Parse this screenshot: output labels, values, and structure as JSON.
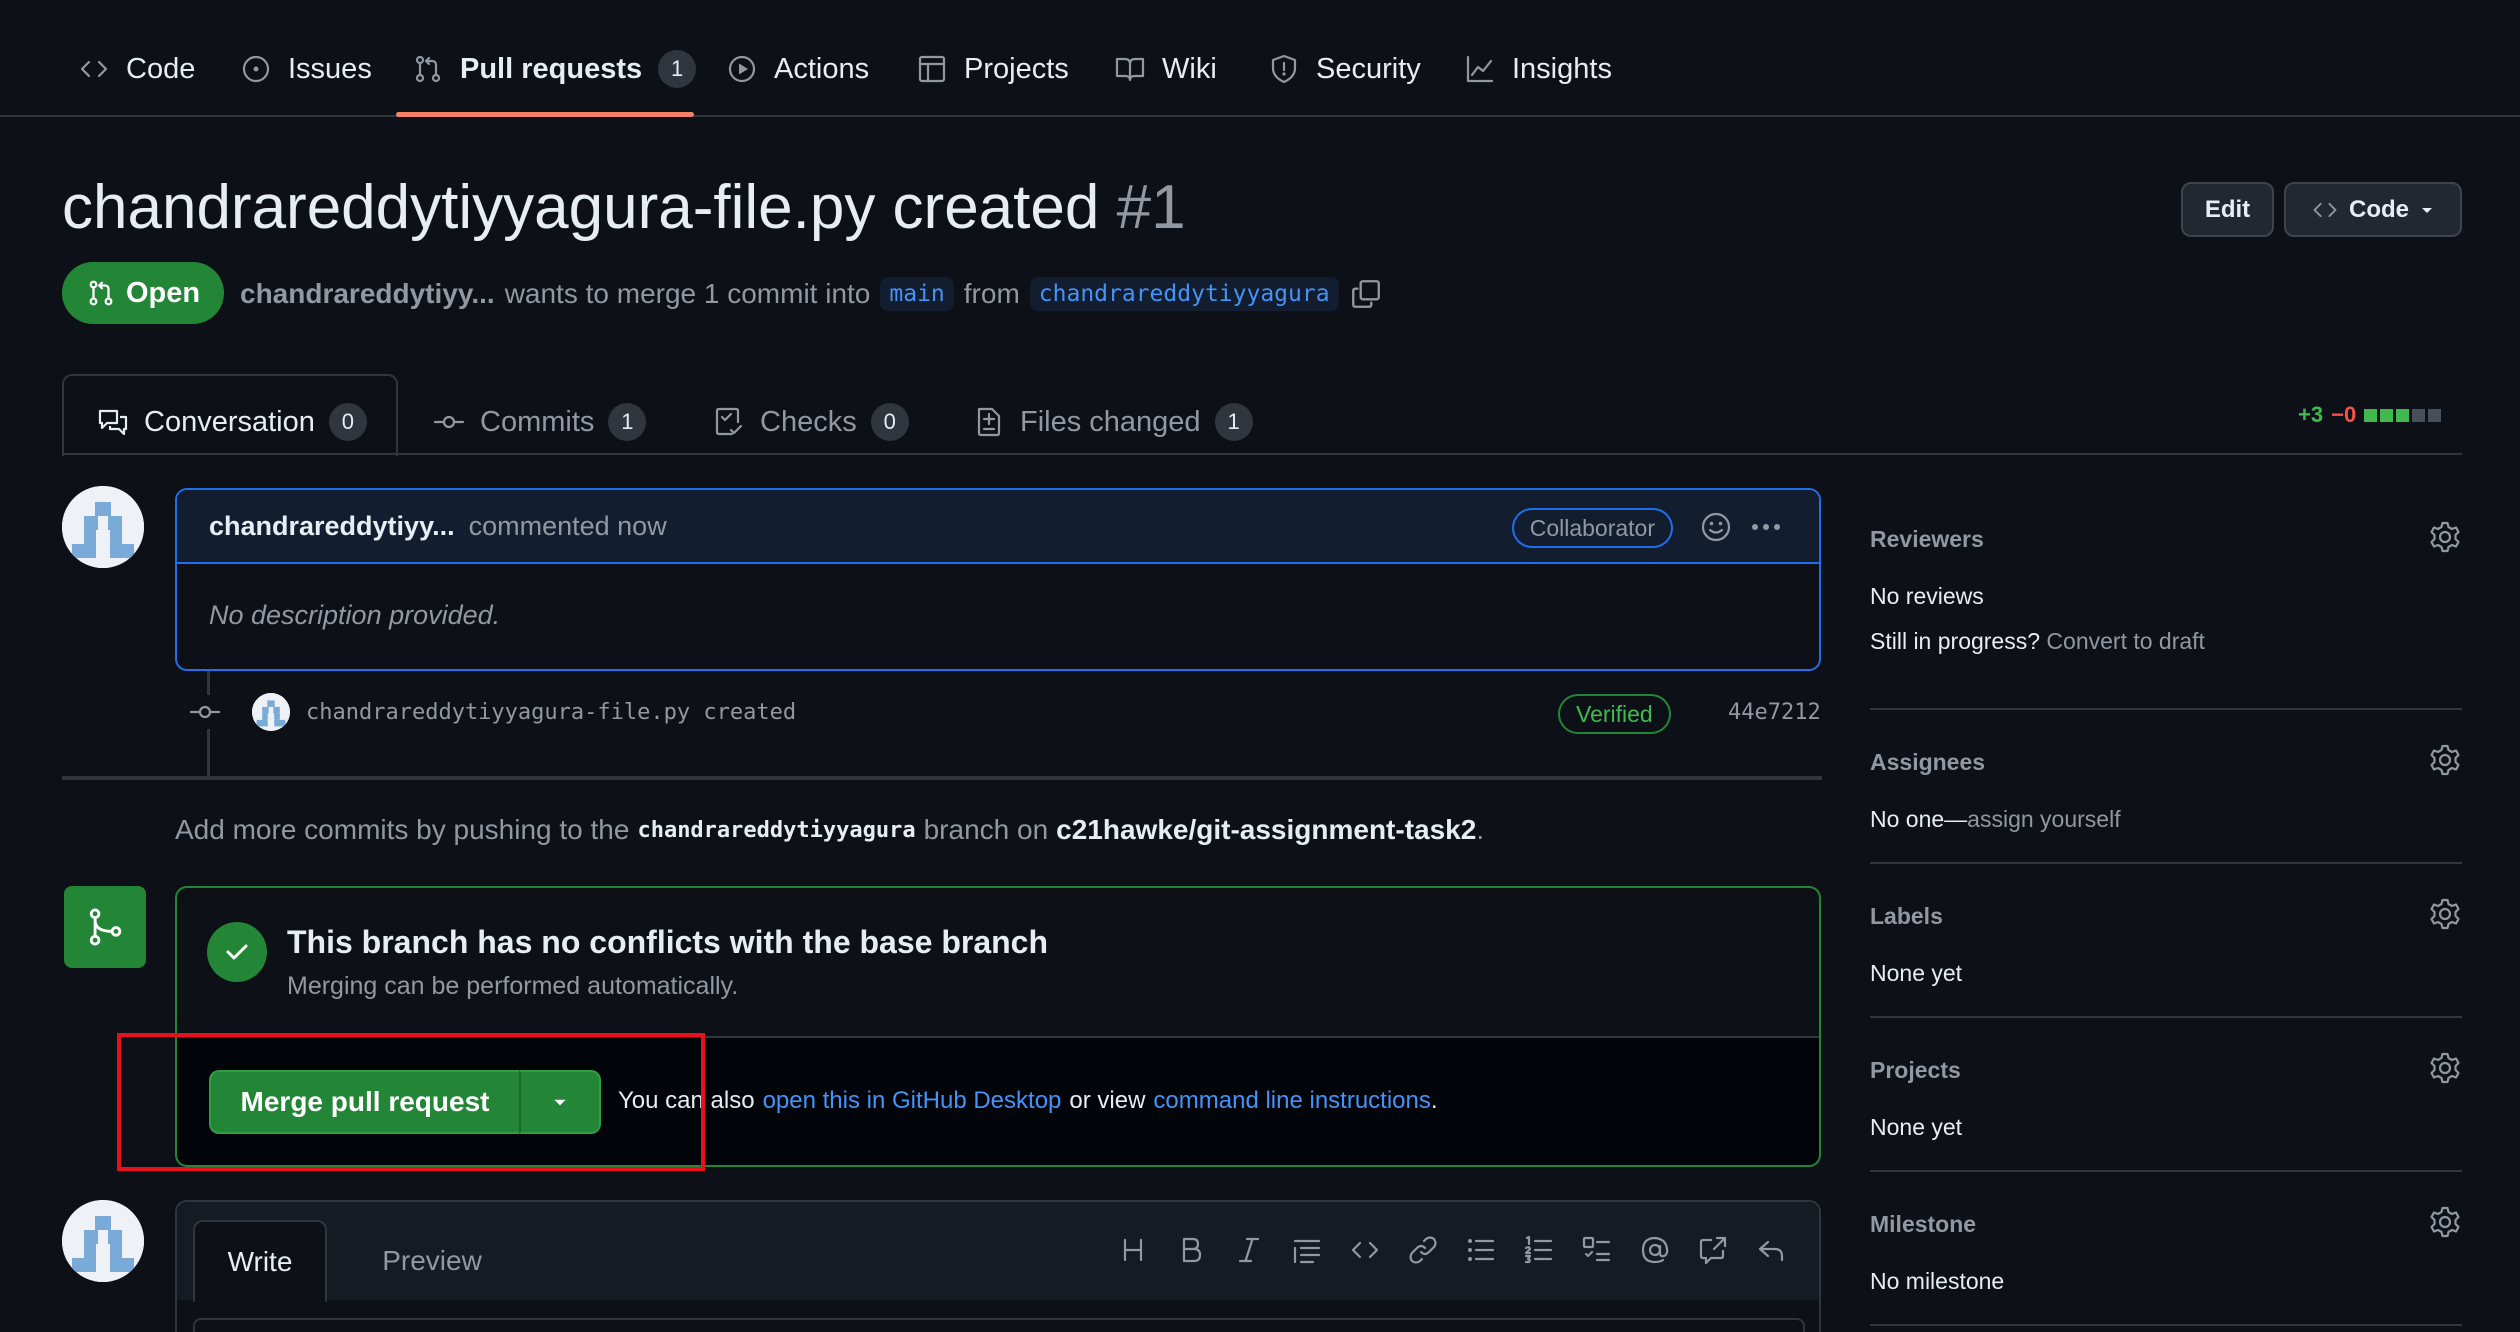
{
  "repo_nav": {
    "items": [
      {
        "label": "Code"
      },
      {
        "label": "Issues"
      },
      {
        "label": "Pull requests",
        "count": "1"
      },
      {
        "label": "Actions"
      },
      {
        "label": "Projects"
      },
      {
        "label": "Wiki"
      },
      {
        "label": "Security"
      },
      {
        "label": "Insights"
      }
    ],
    "active": "Pull requests"
  },
  "pr": {
    "title": "chandrareddytiyyagura-file.py created",
    "number": "#1",
    "state": "Open",
    "author": "chandrareddytiyy...",
    "merge_text": "wants to merge 1 commit into",
    "base_branch": "main",
    "from_text": "from",
    "head_branch": "chandrareddytiyyagura",
    "edit_label": "Edit",
    "code_label": "Code"
  },
  "tabs": [
    {
      "label": "Conversation",
      "count": "0"
    },
    {
      "label": "Commits",
      "count": "1"
    },
    {
      "label": "Checks",
      "count": "0"
    },
    {
      "label": "Files changed",
      "count": "1"
    }
  ],
  "diffstat": {
    "additions": "+3",
    "deletions": "−0"
  },
  "comment": {
    "author": "chandrareddytiyy...",
    "action": "commented now",
    "role": "Collaborator",
    "body": "No description provided."
  },
  "commit": {
    "message": "chandrareddytiyyagura-file.py created",
    "verified": "Verified",
    "sha": "44e7212"
  },
  "add_more": {
    "prefix": "Add more commits by pushing to the",
    "branch": "chandrareddytiyyagura",
    "middle": "branch on",
    "repo": "c21hawke/git-assignment-task2",
    "suffix": "."
  },
  "merge": {
    "title": "This branch has no conflicts with the base branch",
    "subtitle": "Merging can be performed automatically.",
    "button": "Merge pull request",
    "alt_prefix": "You can also",
    "desktop_link": "open this in GitHub Desktop",
    "alt_middle": "or view",
    "cli_link": "command line instructions",
    "alt_suffix": "."
  },
  "editor": {
    "write_tab": "Write",
    "preview_tab": "Preview"
  },
  "sidebar": {
    "reviewers": {
      "title": "Reviewers",
      "value": "No reviews",
      "draft_prefix": "Still in progress?",
      "draft_link": "Convert to draft"
    },
    "assignees": {
      "title": "Assignees",
      "value": "No one—",
      "link": "assign yourself"
    },
    "labels": {
      "title": "Labels",
      "value": "None yet"
    },
    "projects": {
      "title": "Projects",
      "value": "None yet"
    },
    "milestone": {
      "title": "Milestone",
      "value": "No milestone"
    }
  },
  "colors": {
    "background": "#0d1117",
    "accent_green": "#238636",
    "link_blue": "#4493f8",
    "nav_underline": "#f78166",
    "highlight_red": "#e5121c"
  }
}
